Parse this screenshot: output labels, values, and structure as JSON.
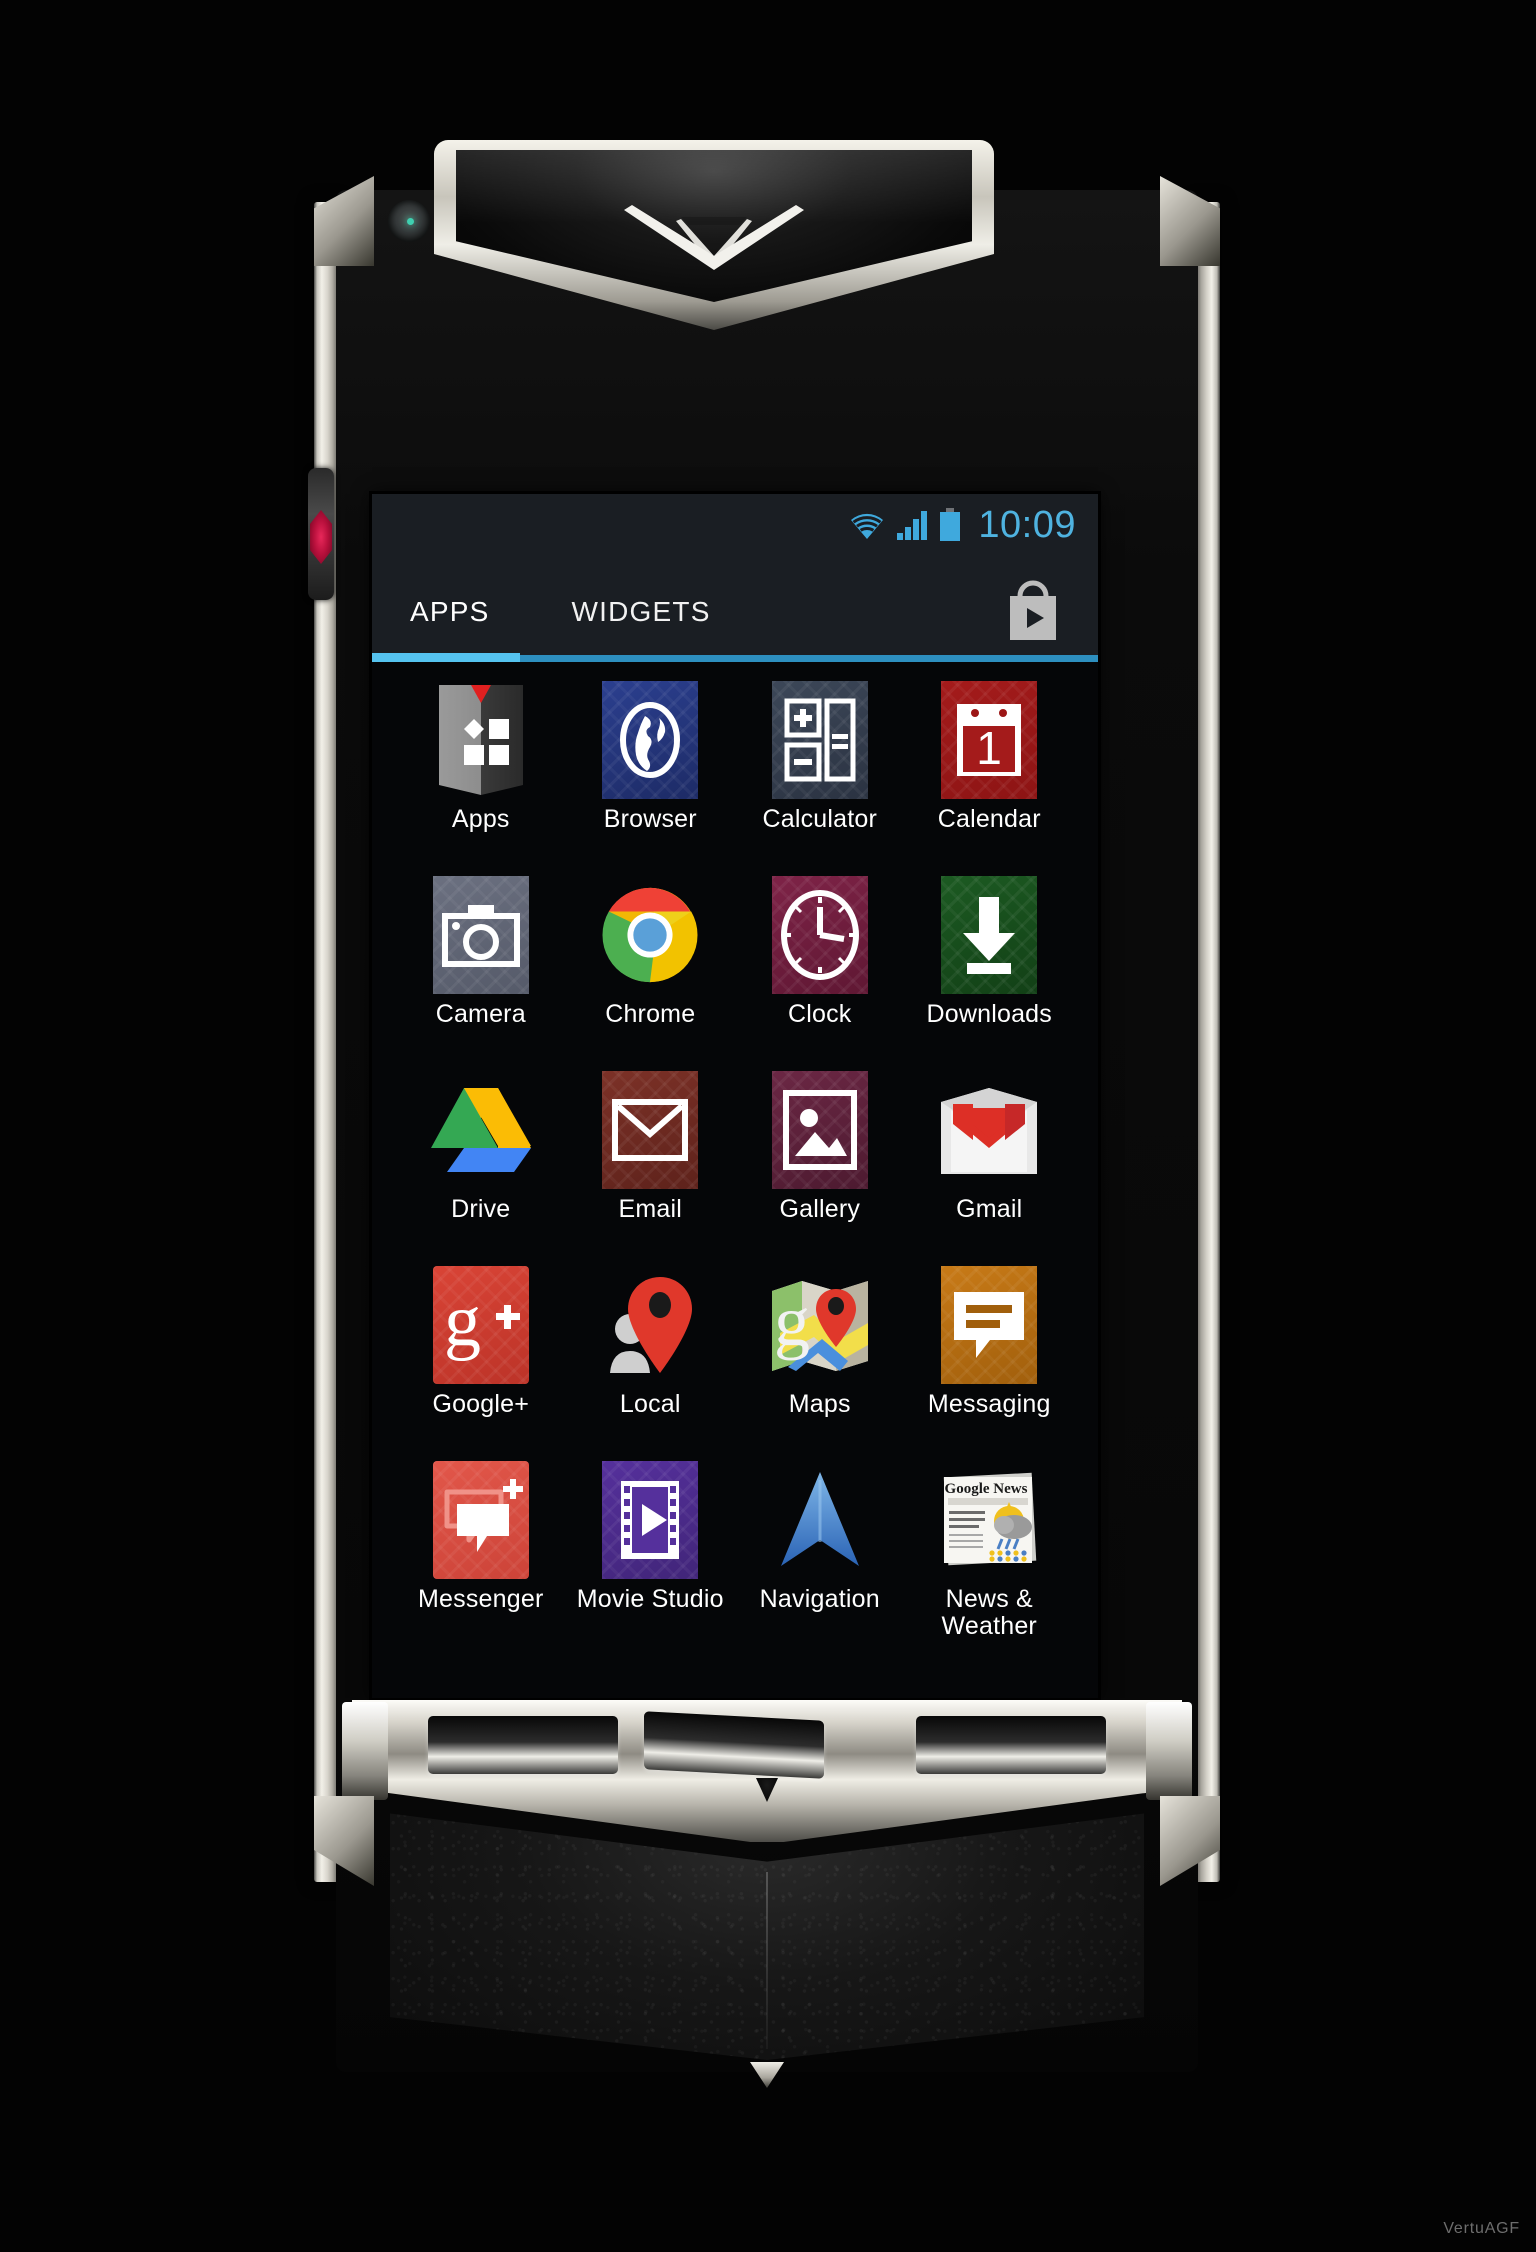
{
  "device": {
    "brand_logo": "vertu-v-logo",
    "camera": "front-camera-lens",
    "side_key": "ruby-side-key"
  },
  "status_bar": {
    "wifi_icon": "wifi-icon",
    "signal_icon": "cellular-signal-icon",
    "battery_icon": "battery-icon",
    "clock": "10:09",
    "accent_color": "#4fb3e0"
  },
  "tabs": {
    "apps_label": "APPS",
    "widgets_label": "WIDGETS",
    "active": "APPS",
    "underline_color": "#55c3ef",
    "play_store_icon": "play-store-bag-icon"
  },
  "apps": [
    {
      "label": "Apps",
      "icon": "apps-drawer-icon"
    },
    {
      "label": "Browser",
      "icon": "browser-globe-icon"
    },
    {
      "label": "Calculator",
      "icon": "calculator-icon"
    },
    {
      "label": "Calendar",
      "icon": "calendar-icon",
      "day": "1"
    },
    {
      "label": "Camera",
      "icon": "camera-icon"
    },
    {
      "label": "Chrome",
      "icon": "chrome-icon"
    },
    {
      "label": "Clock",
      "icon": "clock-icon"
    },
    {
      "label": "Downloads",
      "icon": "downloads-icon"
    },
    {
      "label": "Drive",
      "icon": "google-drive-icon"
    },
    {
      "label": "Email",
      "icon": "email-envelope-icon"
    },
    {
      "label": "Gallery",
      "icon": "gallery-photo-icon"
    },
    {
      "label": "Gmail",
      "icon": "gmail-icon"
    },
    {
      "label": "Google+",
      "icon": "google-plus-icon"
    },
    {
      "label": "Local",
      "icon": "local-pin-icon"
    },
    {
      "label": "Maps",
      "icon": "google-maps-icon"
    },
    {
      "label": "Messaging",
      "icon": "messaging-bubble-icon"
    },
    {
      "label": "Messenger",
      "icon": "messenger-icon"
    },
    {
      "label": "Movie Studio",
      "icon": "movie-studio-film-icon"
    },
    {
      "label": "Navigation",
      "icon": "navigation-arrow-icon"
    },
    {
      "label": "News & Weather",
      "icon": "news-weather-icon",
      "headline": "Google News"
    }
  ],
  "navbar": {
    "back": "back-arrow-icon",
    "home": "home-diamond-icon",
    "recents": "recent-apps-icon"
  },
  "watermark": "VertuAGF"
}
